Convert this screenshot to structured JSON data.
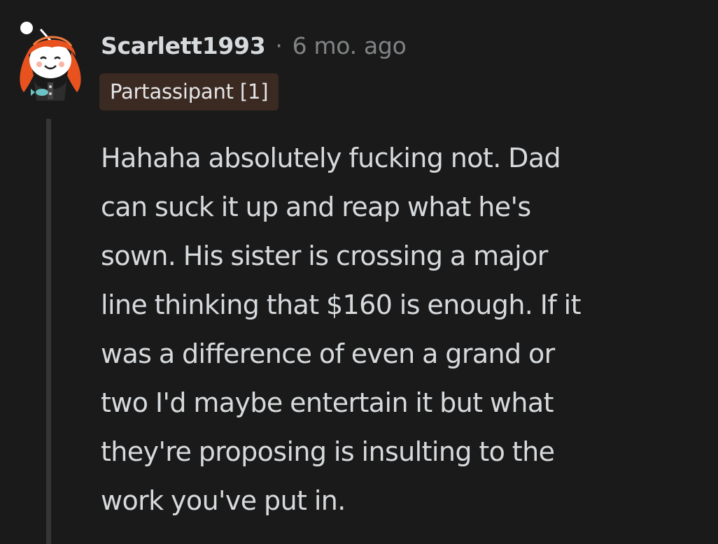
{
  "comment": {
    "author": {
      "username": "Scarlett1993",
      "separator": "·",
      "timestamp": "6 mo. ago",
      "flair": "Partassipant [1]",
      "avatar_icon": "snoo-avatar-icon",
      "avatar_hair_color": "#e8521f"
    },
    "body_lines": [
      "Hahaha absolutely fucking not. Dad",
      "can suck it up and reap what he's",
      "sown. His sister is crossing a major",
      "line thinking that $160 is enough. If it",
      "was a difference of even a grand or",
      "two I'd maybe entertain it but what",
      "they're proposing is insulting to the",
      "work you've put in."
    ]
  },
  "colors": {
    "background": "#1a1a1b",
    "text": "#d7dadc",
    "muted": "#818384",
    "flair_bg": "#3b2a22",
    "thread_line": "#343536"
  }
}
